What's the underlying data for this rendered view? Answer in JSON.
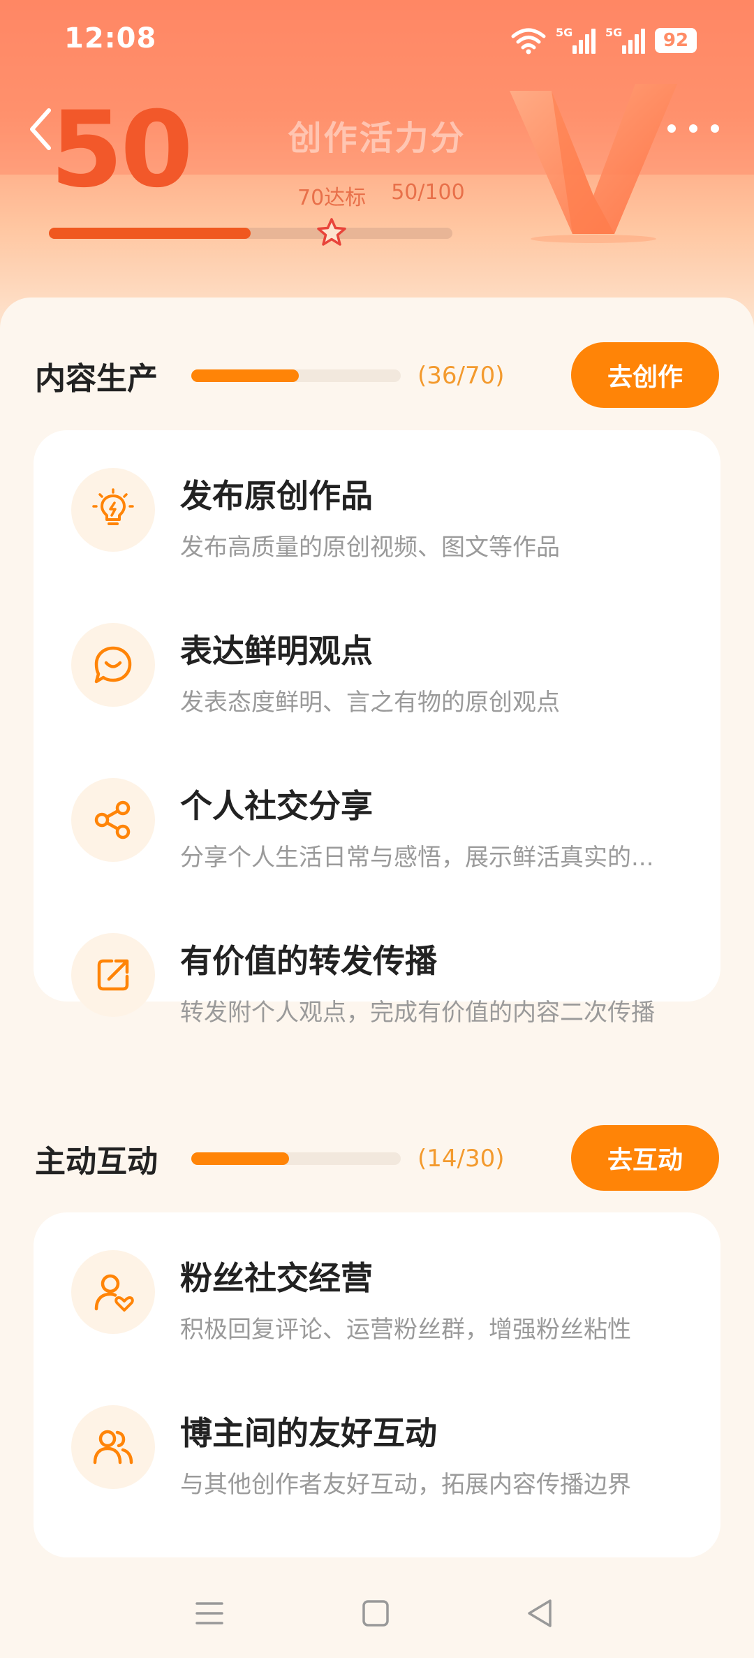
{
  "status_bar": {
    "time": "12:08",
    "network_1": "5G",
    "network_2": "5G",
    "battery": "92"
  },
  "header": {
    "score": "50",
    "title": "创作活力分",
    "target_label": "70达标",
    "progress_text": "50/100",
    "progress_fraction": 0.5,
    "target_fraction": 0.7
  },
  "sections": [
    {
      "title": "内容生产",
      "count": "(36/70)",
      "progress_fraction": 0.514,
      "button_label": "去创作",
      "items": [
        {
          "icon": "lightbulb-icon",
          "title": "发布原创作品",
          "desc": "发布高质量的原创视频、图文等作品"
        },
        {
          "icon": "chat-smile-icon",
          "title": "表达鲜明观点",
          "desc": "发表态度鲜明、言之有物的原创观点"
        },
        {
          "icon": "share-icon",
          "title": "个人社交分享",
          "desc": "分享个人生活日常与感悟，展示鲜活真实的..."
        },
        {
          "icon": "forward-icon",
          "title": "有价值的转发传播",
          "desc": "转发附个人观点，完成有价值的内容二次传播"
        }
      ]
    },
    {
      "title": "主动互动",
      "count": "(14/30)",
      "progress_fraction": 0.467,
      "button_label": "去互动",
      "items": [
        {
          "icon": "user-heart-icon",
          "title": "粉丝社交经营",
          "desc": "积极回复评论、运营粉丝群，增强粉丝粘性"
        },
        {
          "icon": "users-icon",
          "title": "博主间的友好互动",
          "desc": "与其他创作者友好互动，拓展内容传播边界"
        }
      ]
    }
  ],
  "colors": {
    "accent": "#ff8407",
    "score": "#f2582a",
    "count": "#f39a2e",
    "icon_bg": "#fef3e6"
  }
}
